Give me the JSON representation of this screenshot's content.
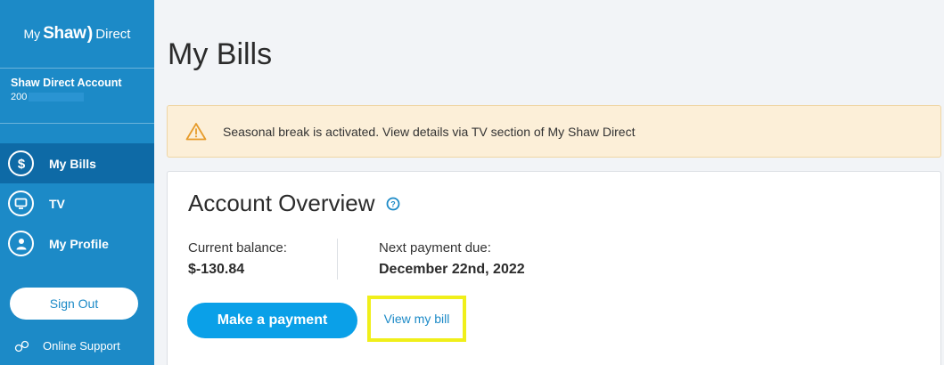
{
  "sidebar": {
    "logo": {
      "my": "My",
      "shaw": "Shaw",
      "direct": "Direct"
    },
    "account": {
      "title": "Shaw Direct Account",
      "number": "200"
    },
    "nav": [
      {
        "label": "My Bills",
        "icon": "dollar-icon",
        "active": true
      },
      {
        "label": "TV",
        "icon": "tv-icon",
        "active": false
      },
      {
        "label": "My Profile",
        "icon": "profile-icon",
        "active": false
      }
    ],
    "sign_out_label": "Sign Out",
    "online_support_label": "Online Support"
  },
  "main": {
    "page_title": "My Bills",
    "alert": {
      "icon": "warning-icon",
      "text": "Seasonal break is activated. View details via TV section of My Shaw Direct"
    },
    "overview": {
      "title": "Account Overview",
      "current_balance_label": "Current balance:",
      "current_balance_value": "$-130.84",
      "next_payment_label": "Next payment due:",
      "next_payment_value": "December 22nd, 2022",
      "make_payment_label": "Make a payment",
      "view_bill_label": "View my bill"
    }
  },
  "colors": {
    "sidebar_bg": "#1c8ac7",
    "sidebar_active": "#0e6aa6",
    "primary_button": "#0aa0e8",
    "alert_bg": "#fcefd8",
    "highlight": "#f0ef1a"
  }
}
